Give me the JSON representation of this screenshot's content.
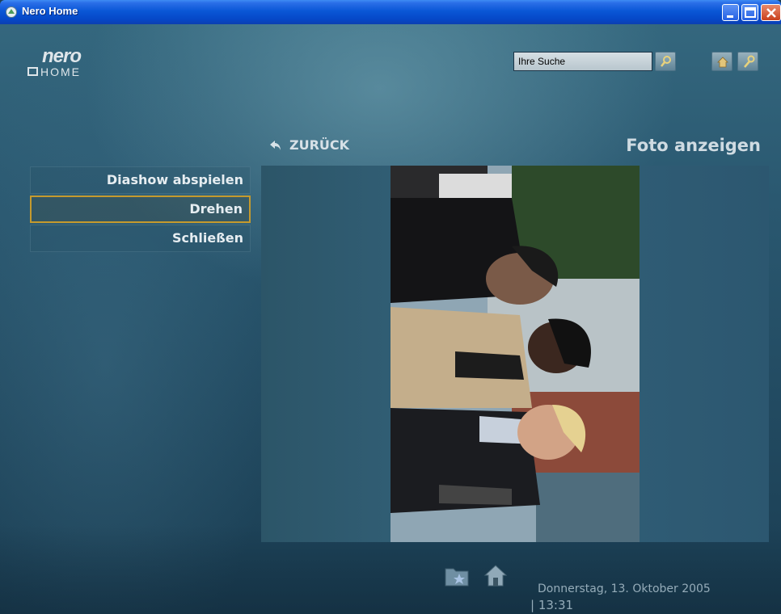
{
  "window": {
    "title": "Nero Home"
  },
  "logo": {
    "brand": "nero",
    "product": "HOME"
  },
  "search": {
    "value": "Ihre Suche"
  },
  "nav": {
    "back_label": "ZURÜCK"
  },
  "page": {
    "title": "Foto anzeigen"
  },
  "menu": {
    "items": [
      {
        "label": "Diashow abspielen"
      },
      {
        "label": "Drehen",
        "active": true
      },
      {
        "label": "Schließen"
      }
    ]
  },
  "status": {
    "date": "Donnerstag, 13. Oktober 2005",
    "time": "| 13:31"
  },
  "colors": {
    "accent_border": "#c59a2d",
    "titlebar": "#0a57d6",
    "background": "#2a5870"
  },
  "icons": [
    "search-icon",
    "home-icon",
    "settings-icon",
    "back-arrow-icon",
    "favorites-folder-icon",
    "home-big-icon"
  ]
}
